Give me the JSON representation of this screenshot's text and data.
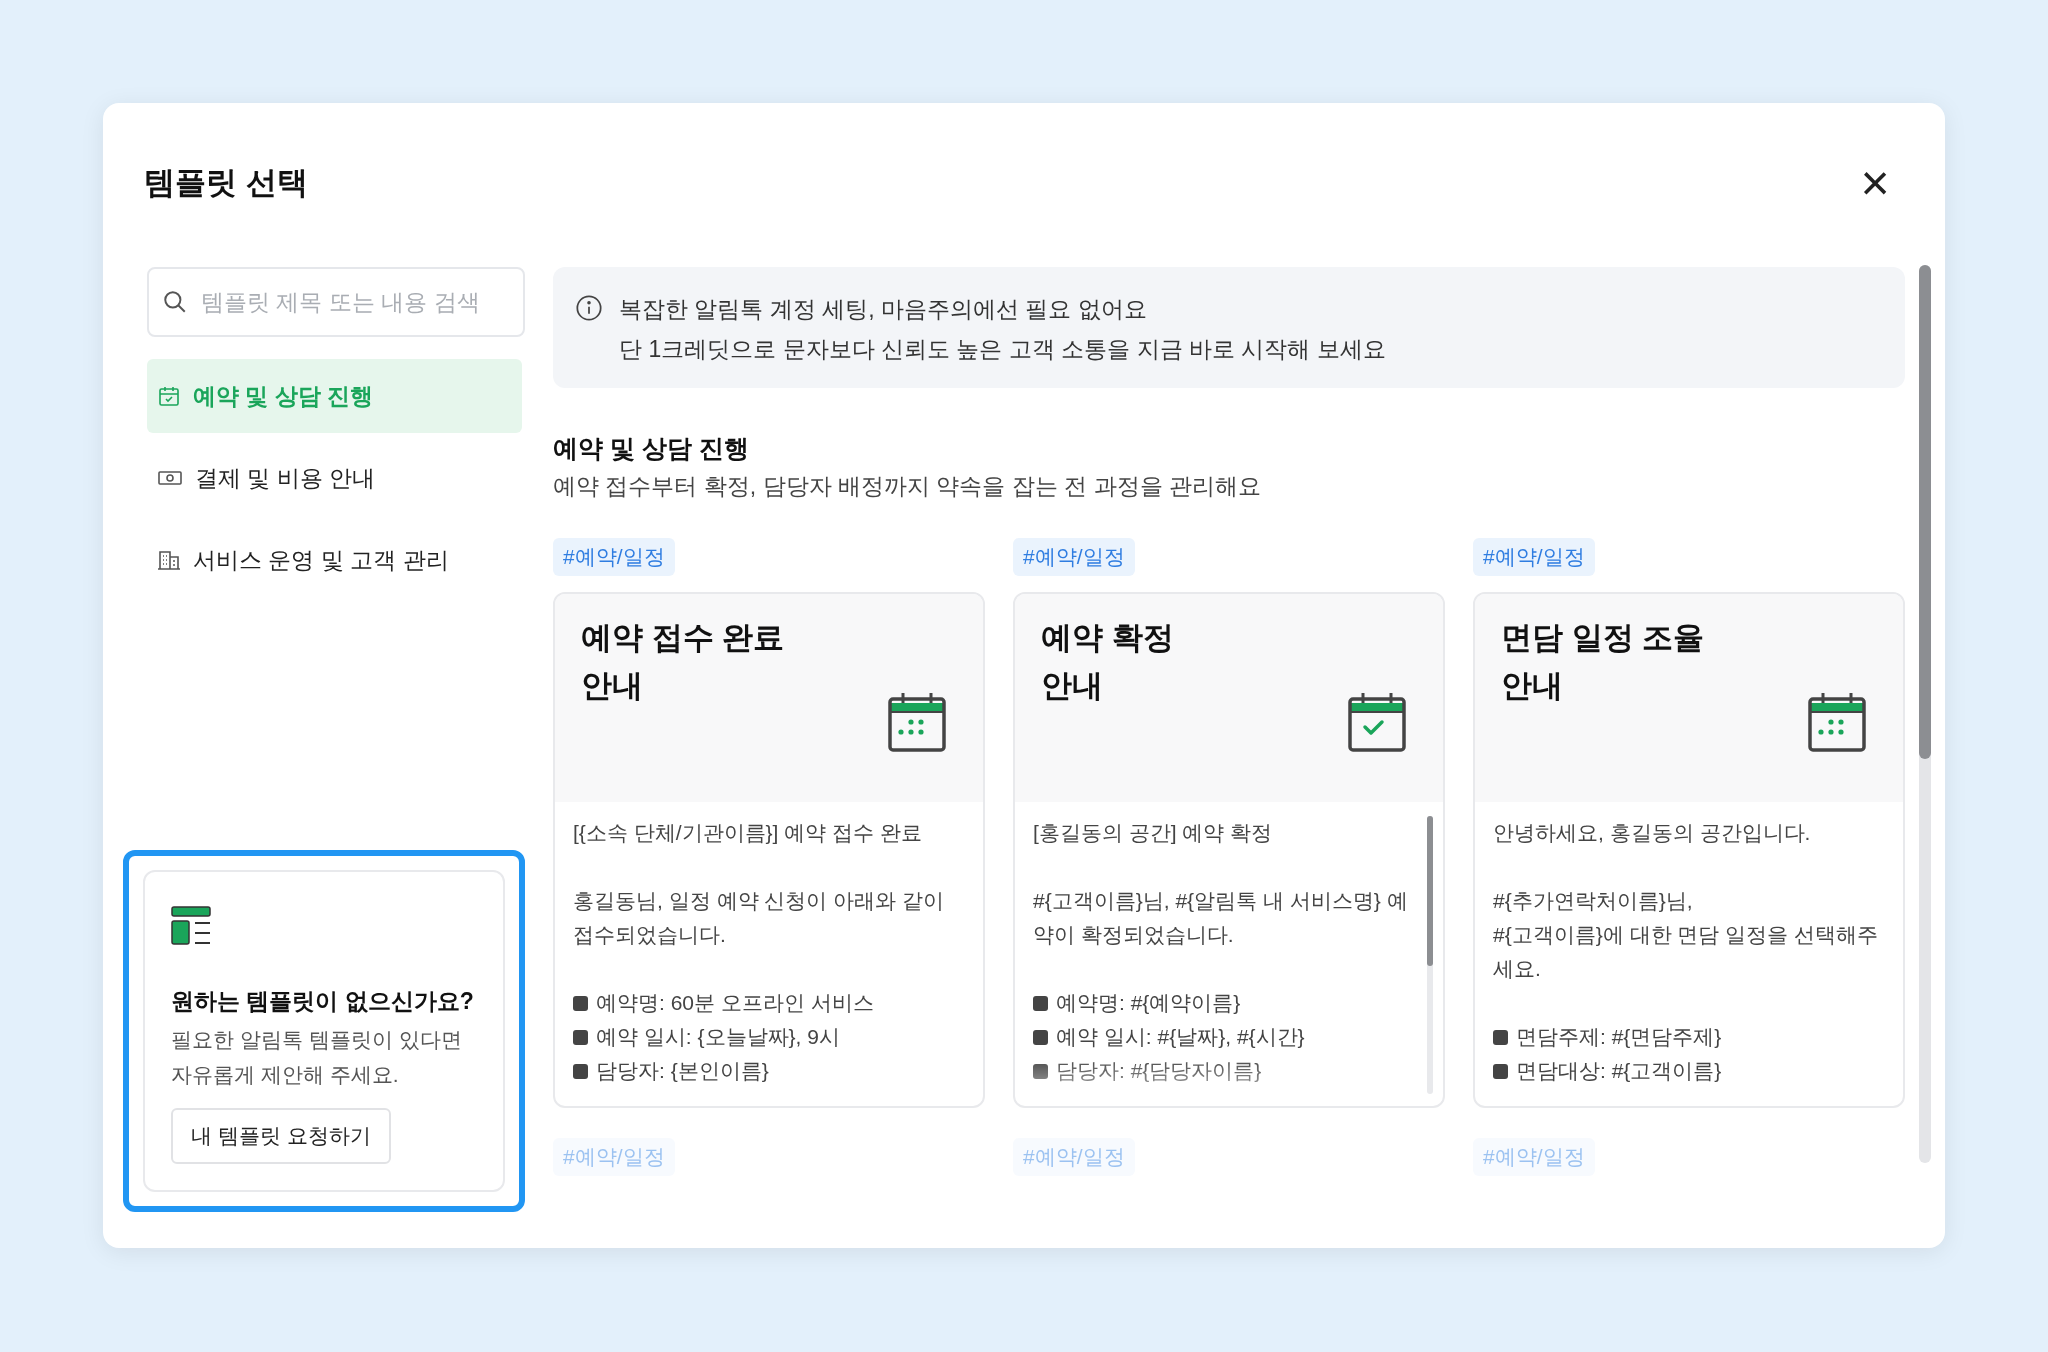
{
  "dialog": {
    "title": "템플릿 선택",
    "close": "×"
  },
  "search": {
    "placeholder": "템플릿 제목 또는 내용 검색"
  },
  "categories": [
    {
      "label": "예약 및 상담 진행",
      "kind": "calendar",
      "selected": true
    },
    {
      "label": "결제 및 비용 안내",
      "kind": "money",
      "selected": false
    },
    {
      "label": "서비스 운영 및 고객 관리",
      "kind": "building",
      "selected": false
    }
  ],
  "request_card": {
    "title": "원하는 템플릿이 없으신가요?",
    "text": "필요한 알림톡 템플릿이 있다면\n자유롭게 제안해 주세요.",
    "button": "내 템플릿 요청하기",
    "highlighted": true
  },
  "notice": {
    "lines": [
      "복잡한 알림톡 계정 세팅, 마음주의에선 필요 없어요",
      "단 1크레딧으로 문자보다 신뢰도 높은 고객 소통을 지금 바로 시작해 보세요"
    ]
  },
  "section": {
    "title": "예약 및 상담 진행",
    "subtitle": "예약 접수부터 확정, 담당자 배정까지 약속을 잡는 전 과정을 관리해요"
  },
  "templates": [
    {
      "tag": "#예약/일정",
      "title": "예약 접수 완료\n안내",
      "kind": "dots",
      "scrollbar": false,
      "body": [
        {
          "kind": "paragraph",
          "text": "[{소속 단체/기관이름}] 예약 접수 완료"
        },
        {
          "kind": "paragraph",
          "text": "홍길동님, 일정 예약 신청이 아래와 같이 접수되었습니다."
        },
        {
          "kind": "bullets",
          "items": [
            "예약명: 60분 오프라인 서비스",
            "예약 일시: {오늘날짜}, 9시",
            "담당자: {본인이름}"
          ]
        }
      ]
    },
    {
      "tag": "#예약/일정",
      "title": "예약 확정\n안내",
      "kind": "check",
      "scrollbar": true,
      "body": [
        {
          "kind": "paragraph",
          "text": "[홍길동의 공간] 예약 확정"
        },
        {
          "kind": "paragraph",
          "text": "#{고객이름}님, #{알림톡 내 서비스명} 예약이 확정되었습니다."
        },
        {
          "kind": "bullets",
          "items": [
            "예약명: #{예약이름}",
            "예약 일시: #{날짜}, #{시간}",
            "담당자: #{담당자이름}"
          ]
        }
      ]
    },
    {
      "tag": "#예약/일정",
      "title": "면담 일정 조율\n안내",
      "kind": "dots",
      "scrollbar": false,
      "body": [
        {
          "kind": "paragraph",
          "text": "안녕하세요, 홍길동의 공간입니다."
        },
        {
          "kind": "paragraph",
          "text": "#{추가연락처이름}님,\n#{고객이름}에 대한 면담 일정을 선택해주세요."
        },
        {
          "kind": "bullets",
          "items": [
            "면담주제: #{면담주제}",
            "면담대상: #{고객이름}"
          ]
        }
      ]
    }
  ],
  "next_tags": [
    "#예약/일정",
    "#예약/일정",
    "#예약/일정"
  ]
}
